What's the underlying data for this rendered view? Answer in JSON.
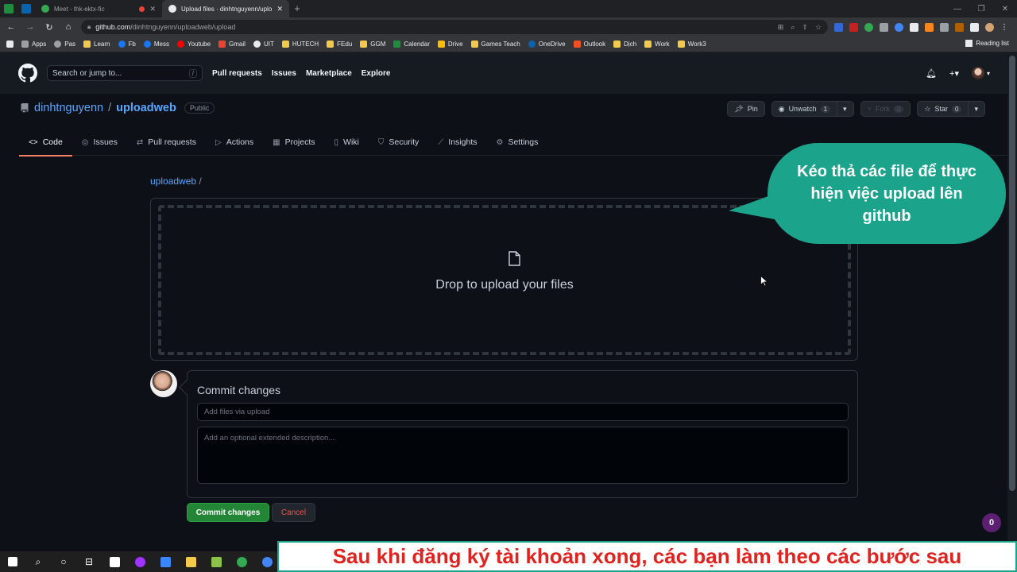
{
  "browser": {
    "tabs": [
      {
        "title": "Meet - thk-ektx-fic"
      },
      {
        "title": "Upload files · dinhtnguyenn/uplo",
        "active": true
      }
    ],
    "new_tab": "+",
    "url_host": "github.com",
    "url_path": "/dinhtnguyenn/uploadweb/upload",
    "bookmarks": [
      "Apps",
      "Pas",
      "Learn",
      "Fb",
      "Mess",
      "Youtube",
      "Gmail",
      "UIT",
      "HUTECH",
      "FEdu",
      "GGM",
      "Calendar",
      "Drive",
      "Games Teach",
      "OneDrive",
      "Outlook",
      "Dịch",
      "Work",
      "Work3"
    ],
    "reading_list": "Reading list"
  },
  "github": {
    "search_placeholder": "Search or jump to...",
    "search_shortcut": "/",
    "nav": [
      "Pull requests",
      "Issues",
      "Marketplace",
      "Explore"
    ],
    "new_menu": "+▾"
  },
  "repo": {
    "owner": "dinhtnguyenn",
    "separator": "/",
    "name": "uploadweb",
    "visibility": "Public",
    "pin_label": "Pin",
    "unwatch_label": "Unwatch",
    "watch_count": "1",
    "fork_label": "Fork",
    "fork_count": "0",
    "star_label": "Star",
    "star_count": "0",
    "tabs": [
      "Code",
      "Issues",
      "Pull requests",
      "Actions",
      "Projects",
      "Wiki",
      "Security",
      "Insights",
      "Settings"
    ]
  },
  "upload": {
    "breadcrumb_repo": "uploadweb",
    "breadcrumb_sep": "/",
    "drop_text": "Drop to upload your files"
  },
  "commit": {
    "title": "Commit changes",
    "summary_placeholder": "Add files via upload",
    "description_placeholder": "Add an optional extended description...",
    "commit_button": "Commit changes",
    "cancel_button": "Cancel"
  },
  "overlay": {
    "callout": "Kéo thả các file để thực hiện việc upload lên github",
    "subtitle": "Sau khi đăng ký tài khoản xong, các bạn làm theo các bước sau",
    "notification_count": "0"
  },
  "colors": {
    "accent_green": "#238636",
    "link_blue": "#58a6ff",
    "callout_teal": "#1ba38b",
    "subtitle_red": "#e0231f"
  }
}
